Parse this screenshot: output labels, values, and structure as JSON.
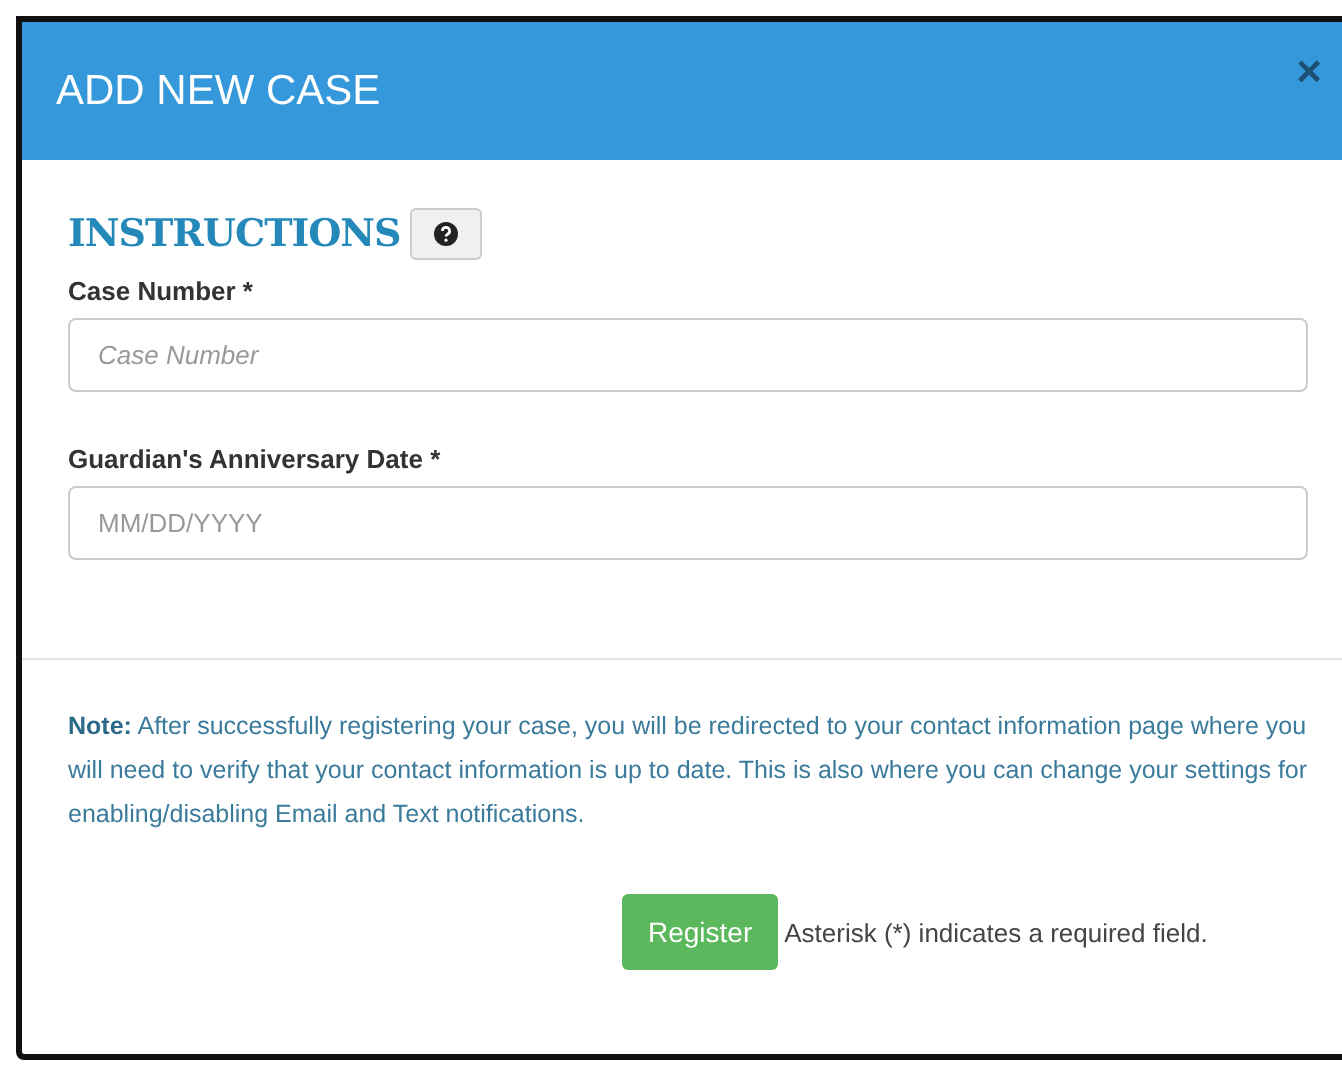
{
  "modal": {
    "title": "ADD NEW CASE",
    "close": "×"
  },
  "heading": "INSTRUCTIONS",
  "fields": [
    {
      "label": "Case Number *",
      "placeholder": "Case Number",
      "italic": true
    },
    {
      "label": "Guardian's Anniversary Date *",
      "placeholder": "MM/DD/YYYY",
      "italic": false
    }
  ],
  "note": "**Note:** After successfully registering your case, you will be redirected to your contact information page where you will need to verify that your contact information is up to date. This is also where you can change your settings for enabling/disabling Email and Text notifications.",
  "register_button": "Register",
  "required_hint": "Asterisk (*) indicates a required field."
}
